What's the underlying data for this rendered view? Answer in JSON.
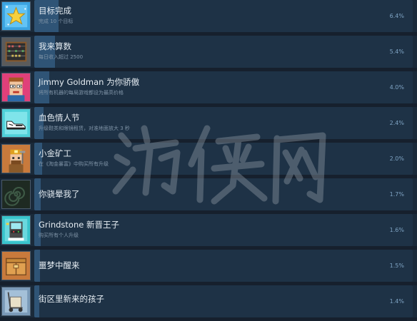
{
  "achievements": [
    {
      "title": "目标完成",
      "desc": "完成 10 个目标",
      "percent": "6.4%",
      "fill": 0.064,
      "icon": "star-badge-icon"
    },
    {
      "title": "我来算数",
      "desc": "每日收入超过 2500",
      "percent": "5.4%",
      "fill": 0.054,
      "icon": "abacus-icon"
    },
    {
      "title": "Jimmy Goldman 为你骄傲",
      "desc": "将所有机器的每局游戏都设为最高价格",
      "percent": "4.0%",
      "fill": 0.04,
      "icon": "jimmy-goldman-portrait-icon"
    },
    {
      "title": "血色情人节",
      "desc": "升级鞋类和眼镜租赁，对准地面放大 3 秒",
      "percent": "2.4%",
      "fill": 0.024,
      "icon": "sneaker-icon"
    },
    {
      "title": "小金矿工",
      "desc": "在《淘金暴富》中购买所有升级",
      "percent": "2.0%",
      "fill": 0.02,
      "icon": "gold-miner-icon"
    },
    {
      "title": "你骁晕我了",
      "desc": "",
      "percent": "1.7%",
      "fill": 0.017,
      "icon": "spiral-icon"
    },
    {
      "title": "Grindstone 新晋王子",
      "desc": "购买所有个人升级",
      "percent": "1.6%",
      "fill": 0.016,
      "icon": "arcade-cabinet-icon"
    },
    {
      "title": "噩梦中醒来",
      "desc": "",
      "percent": "1.5%",
      "fill": 0.015,
      "icon": "crate-icon"
    },
    {
      "title": "街区里新来的孩子",
      "desc": "",
      "percent": "1.4%",
      "fill": 0.014,
      "icon": "hand-truck-icon"
    }
  ],
  "watermark": {
    "text": "游侠网"
  }
}
